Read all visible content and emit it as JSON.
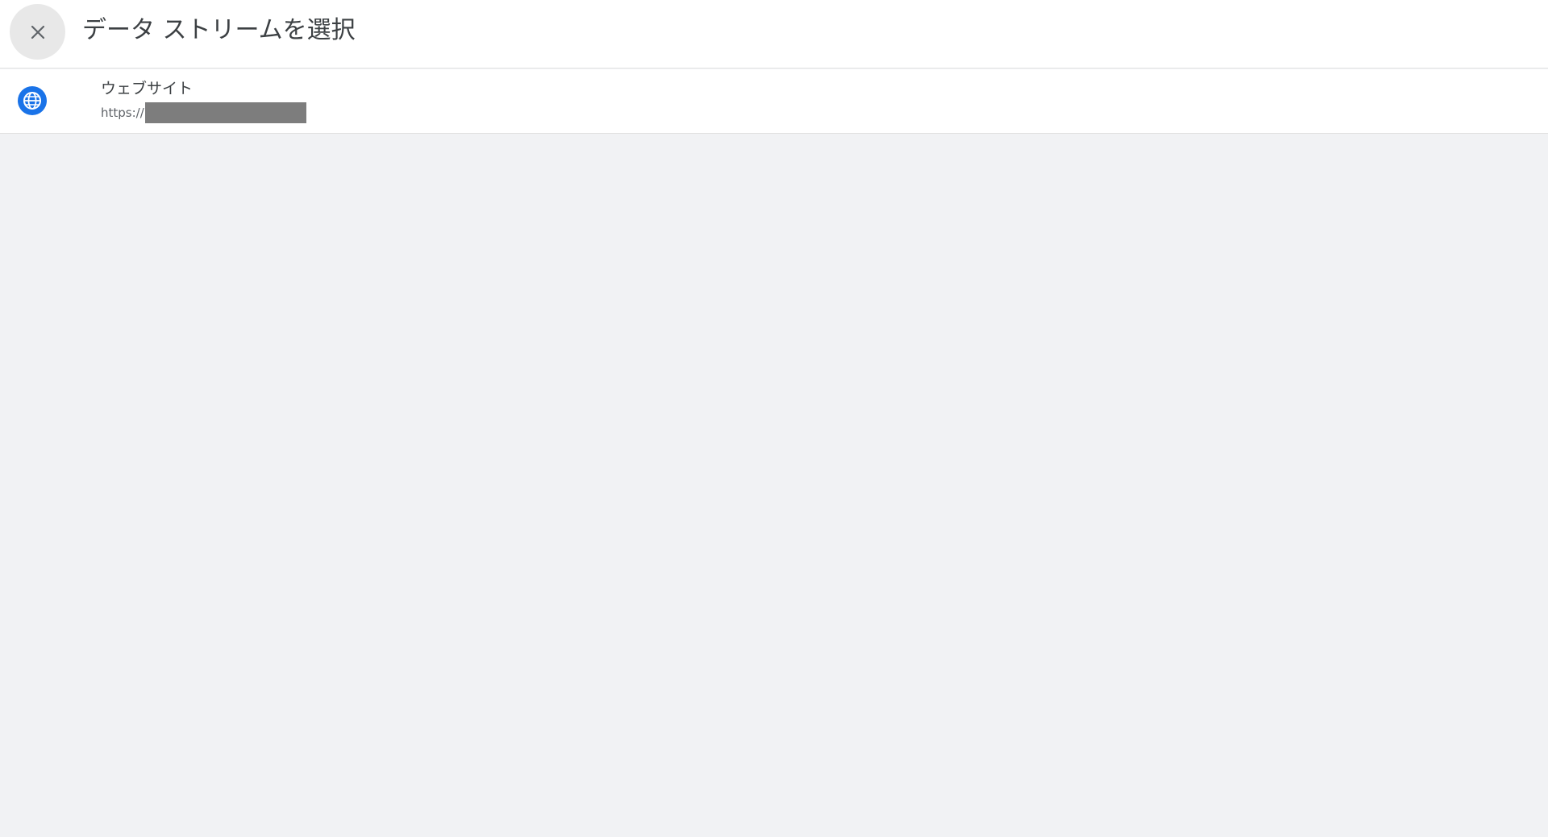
{
  "header": {
    "title": "データ ストリームを選択",
    "close_icon": "close-icon"
  },
  "streams": [
    {
      "icon": "globe-icon",
      "name": "ウェブサイト",
      "url_prefix": "https://",
      "url_redacted": true
    }
  ],
  "colors": {
    "accent": "#1a73e8",
    "background": "#f1f2f4",
    "surface": "#ffffff",
    "redaction": "#7d7d7d"
  }
}
